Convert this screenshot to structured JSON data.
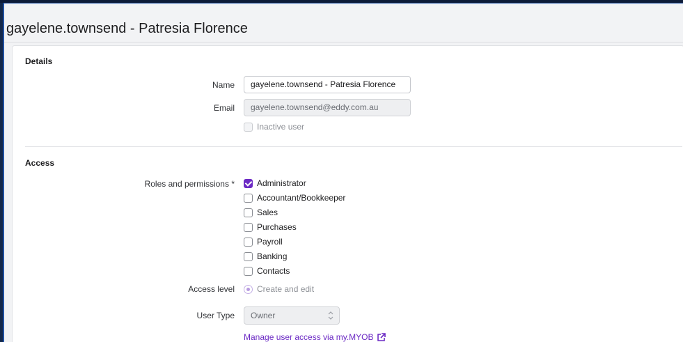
{
  "page": {
    "title": "gayelene.townsend - Patresia Florence"
  },
  "details": {
    "section_title": "Details",
    "name_label": "Name",
    "name_value": "gayelene.townsend - Patresia Florence",
    "email_label": "Email",
    "email_value": "gayelene.townsend@eddy.com.au",
    "inactive_label": "Inactive user",
    "inactive_checked": false
  },
  "access": {
    "section_title": "Access",
    "roles_label": "Roles and permissions *",
    "roles": [
      {
        "label": "Administrator",
        "checked": true
      },
      {
        "label": "Accountant/Bookkeeper",
        "checked": false
      },
      {
        "label": "Sales",
        "checked": false
      },
      {
        "label": "Purchases",
        "checked": false
      },
      {
        "label": "Payroll",
        "checked": false
      },
      {
        "label": "Banking",
        "checked": false
      },
      {
        "label": "Contacts",
        "checked": false
      }
    ],
    "access_level_label": "Access level",
    "access_level_value": "Create and edit",
    "user_type_label": "User Type",
    "user_type_value": "Owner",
    "manage_link": "Manage user access via my.MYOB"
  },
  "colors": {
    "accent": "#6c2ac4",
    "frame_border": "#1f4fa0",
    "page_bg": "#f2f3f5",
    "card_bg": "#ffffff"
  },
  "icons": {
    "checkbox_checked": "check-icon",
    "select_arrows": "chevron-up-down-icon",
    "external_link": "external-link-icon"
  }
}
